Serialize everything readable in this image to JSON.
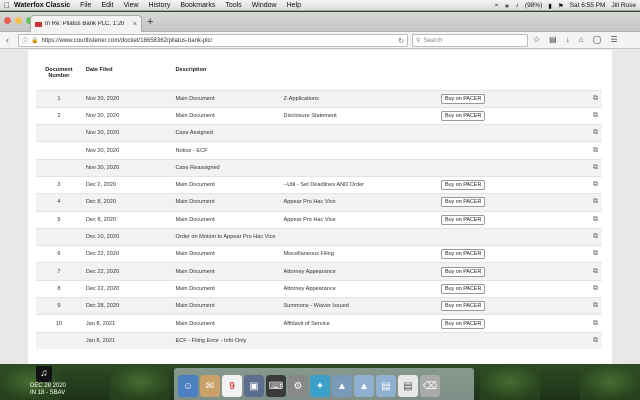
{
  "menubar": {
    "app_name": "Waterfox Classic",
    "items": [
      "File",
      "Edit",
      "View",
      "History",
      "Bookmarks",
      "Tools",
      "Window",
      "Help"
    ],
    "battery": "(98%)",
    "clock": "Sat 6:55 PM",
    "user": "Jill Rose"
  },
  "browser": {
    "tab_title": "In Re: Pilatus Bank PLC, 1:20",
    "url": "https://www.courtlistener.com/docket/18658362/pilatus-bank-plc/",
    "search_placeholder": "Search"
  },
  "docket": {
    "headers": {
      "number": "Document Number",
      "date": "Date Filed",
      "description": "Description"
    },
    "pacer_label": "Buy on PACER",
    "rows": [
      {
        "num": "1",
        "date": "Nov 20, 2020",
        "desc": "Main Document",
        "detail": "Z-Applications",
        "pacer": true
      },
      {
        "num": "2",
        "date": "Nov 20, 2020",
        "desc": "Main Document",
        "detail": "Disclosure Statement",
        "pacer": true
      },
      {
        "num": "",
        "date": "Nov 20, 2020",
        "desc": "Case Assigned",
        "detail": "",
        "pacer": false
      },
      {
        "num": "",
        "date": "Nov 20, 2020",
        "desc": "Notice - ECF",
        "detail": "",
        "pacer": false
      },
      {
        "num": "",
        "date": "Nov 30, 2020",
        "desc": "Case Reassigned",
        "detail": "",
        "pacer": false
      },
      {
        "num": "3",
        "date": "Dec 2, 2020",
        "desc": "Main Document",
        "detail": "--Util - Set Deadlines AND Order",
        "pacer": true
      },
      {
        "num": "4",
        "date": "Dec 8, 2020",
        "desc": "Main Document",
        "detail": "Appear Pro Hac Vice",
        "pacer": true
      },
      {
        "num": "5",
        "date": "Dec 8, 2020",
        "desc": "Main Document",
        "detail": "Appear Pro Hac Vice",
        "pacer": true
      },
      {
        "num": "",
        "date": "Dec 10, 2020",
        "desc": "Order on Motion to Appear Pro Hac Vice",
        "detail": "",
        "pacer": false
      },
      {
        "num": "6",
        "date": "Dec 22, 2020",
        "desc": "Main Document",
        "detail": "Miscellaneous Filing",
        "pacer": true
      },
      {
        "num": "7",
        "date": "Dec 22, 2020",
        "desc": "Main Document",
        "detail": "Attorney Appearance",
        "pacer": true
      },
      {
        "num": "8",
        "date": "Dec 22, 2020",
        "desc": "Main Document",
        "detail": "Attorney Appearance",
        "pacer": true
      },
      {
        "num": "9",
        "date": "Dec 28, 2020",
        "desc": "Main Document",
        "detail": "Summons - Waiver Issued",
        "pacer": true
      },
      {
        "num": "10",
        "date": "Jan 8, 2021",
        "desc": "Main Document",
        "detail": "Affidavit of Service",
        "pacer": true
      },
      {
        "num": "",
        "date": "Jan 8, 2021",
        "desc": "ECF - Filing Error - Info Only",
        "detail": "",
        "pacer": false
      }
    ]
  },
  "desktop": {
    "clock_date": "DEC 28 2020",
    "clock_time": "IN 18 - SBAV"
  }
}
